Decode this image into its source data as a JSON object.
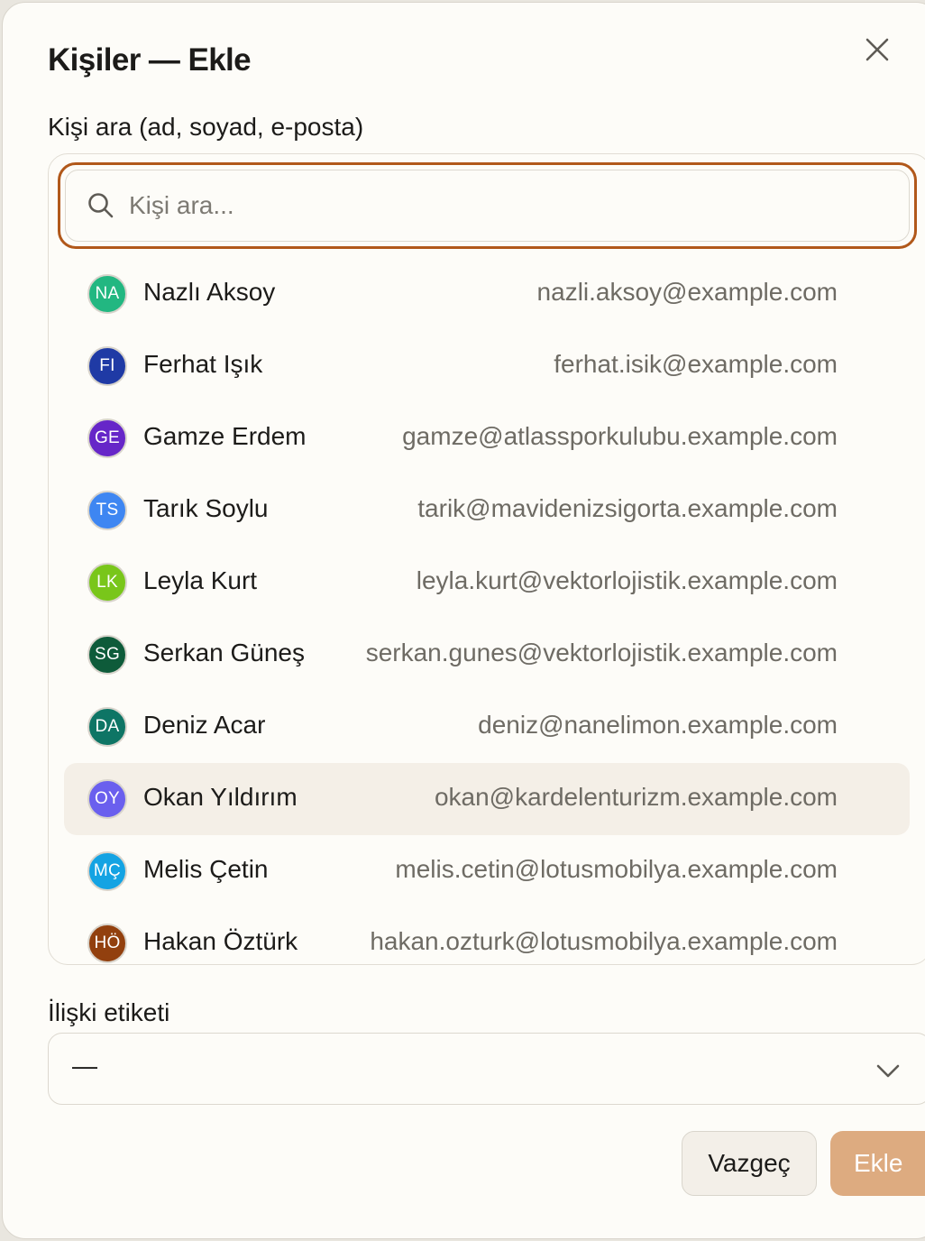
{
  "dialog": {
    "title": "Kişiler — Ekle",
    "close_icon": "close-icon"
  },
  "search": {
    "label": "Kişi ara (ad, soyad, e-posta)",
    "placeholder": "Kişi ara...",
    "value": "",
    "icon": "search-icon",
    "focus_color": "#b1581a"
  },
  "contacts": [
    {
      "initials": "NA",
      "name": "Nazlı Aksoy",
      "email": "nazli.aksoy@example.com",
      "color": "#22b781"
    },
    {
      "initials": "FI",
      "name": "Ferhat Işık",
      "email": "ferhat.isik@example.com",
      "color": "#1f3aa5"
    },
    {
      "initials": "GE",
      "name": "Gamze Erdem",
      "email": "gamze@atlassporkulubu.example.com",
      "color": "#6626c8"
    },
    {
      "initials": "TS",
      "name": "Tarık Soylu",
      "email": "tarik@mavidenizsigorta.example.com",
      "color": "#3e86f2"
    },
    {
      "initials": "LK",
      "name": "Leyla Kurt",
      "email": "leyla.kurt@vektorlojistik.example.com",
      "color": "#79c61a"
    },
    {
      "initials": "SG",
      "name": "Serkan Güneş",
      "email": "serkan.gunes@vektorlojistik.example.com",
      "color": "#0e5b3a"
    },
    {
      "initials": "DA",
      "name": "Deniz Acar",
      "email": "deniz@nanelimon.example.com",
      "color": "#0e7565"
    },
    {
      "initials": "OY",
      "name": "Okan Yıldırım",
      "email": "okan@kardelenturizm.example.com",
      "color": "#6a5fee",
      "highlighted": true
    },
    {
      "initials": "MÇ",
      "name": "Melis Çetin",
      "email": "melis.cetin@lotusmobilya.example.com",
      "color": "#14a3e3"
    },
    {
      "initials": "HÖ",
      "name": "Hakan Öztürk",
      "email": "hakan.ozturk@lotusmobilya.example.com",
      "color": "#92400e"
    }
  ],
  "relation": {
    "label": "İlişki etiketi",
    "selected": "—",
    "icon": "chevron-down-icon"
  },
  "actions": {
    "cancel_label": "Vazgeç",
    "add_label": "Ekle",
    "add_color": "#ddab80"
  }
}
